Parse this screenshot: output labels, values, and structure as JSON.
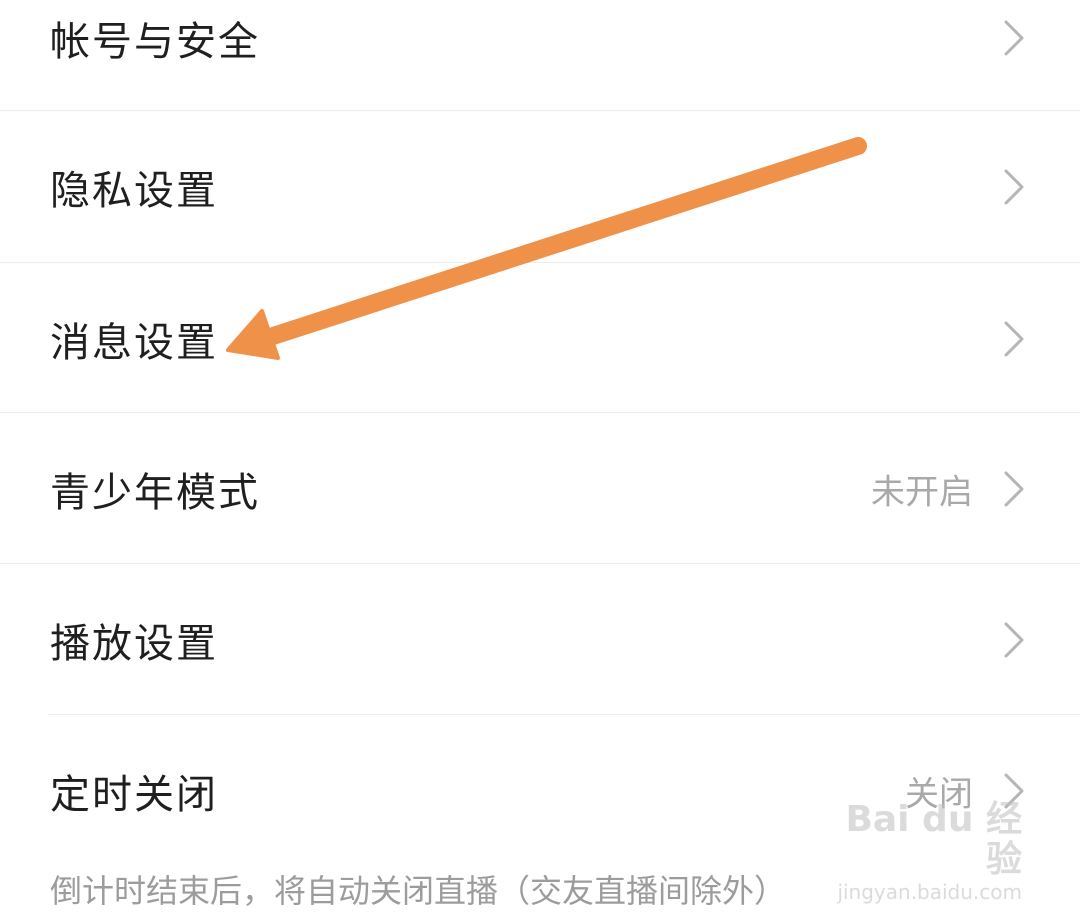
{
  "settings": {
    "items": [
      {
        "label": "帐号与安全",
        "value": ""
      },
      {
        "label": "隐私设置",
        "value": ""
      },
      {
        "label": "消息设置",
        "value": ""
      },
      {
        "label": "青少年模式",
        "value": "未开启"
      },
      {
        "label": "播放设置",
        "value": ""
      },
      {
        "label": "定时关闭",
        "value": "关闭"
      }
    ],
    "hint": "倒计时结束后，将自动关闭直播（交友直播间除外）"
  },
  "annotation": {
    "arrow_color": "#f0914a"
  },
  "watermark": {
    "brand": "Bai du 经验",
    "url": "jingyan.baidu.com"
  },
  "icons": {
    "chevron": "chevron-right-icon"
  }
}
